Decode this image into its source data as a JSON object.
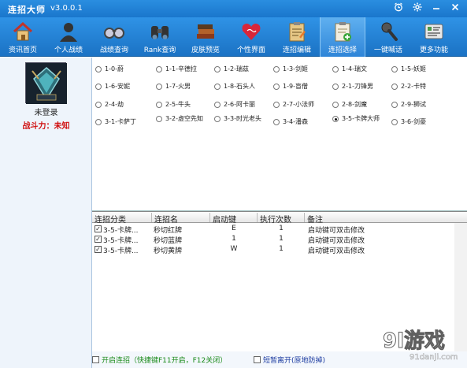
{
  "window": {
    "title": "连招大师",
    "version": "v3.0.0.1",
    "buttons": [
      "alarm-clock-icon",
      "gear-icon",
      "minimize-icon",
      "close-icon"
    ]
  },
  "toolbar": {
    "items": [
      {
        "label": "资讯首页",
        "icon": "house-icon"
      },
      {
        "label": "个人战绩",
        "icon": "user-silhouette-icon"
      },
      {
        "label": "战绩查询",
        "icon": "glasses-icon"
      },
      {
        "label": "Rank查询",
        "icon": "binoculars-icon"
      },
      {
        "label": "皮肤预览",
        "icon": "books-icon"
      },
      {
        "label": "个性界面",
        "icon": "heart-icon"
      },
      {
        "label": "连招编辑",
        "icon": "clipboard-edit-icon"
      },
      {
        "label": "连招选择",
        "icon": "clipboard-add-icon"
      },
      {
        "label": "一键喊话",
        "icon": "microphone-icon"
      },
      {
        "label": "更多功能",
        "icon": "more-apps-icon"
      }
    ],
    "active_index": 7
  },
  "sidebar": {
    "login_status": "未登录",
    "power_label": "战斗力：未知"
  },
  "combos": [
    [
      "1-0-蔚",
      "1-1-辛德拉",
      "1-2-瑞兹",
      "1-3-剑姬",
      "1-4-瑞文",
      "1-5-妖姬"
    ],
    [
      "1-6-安妮",
      "1-7-火男",
      "1-8-石头人",
      "1-9-盲僧",
      "2-1-刀锋男",
      "2-2-卡特"
    ],
    [
      "2-4-劫",
      "2-5-牛头",
      "2-6-阿卡丽",
      "2-7-小法师",
      "2-8-剑魔",
      "2-9-狮试"
    ],
    [
      "3-1-卡萨丁",
      "3-2-虚空先知",
      "3-3-时光老头",
      "3-4-潘森",
      "3-5-卡牌大师",
      "3-6-剑豪"
    ]
  ],
  "selected_combo": "3-5-卡牌大师",
  "table": {
    "headers": [
      "连招分类",
      "连招名",
      "启动键",
      "执行次数",
      "备注"
    ],
    "rows": [
      {
        "category": "3-5-卡牌...",
        "name": "秒切红牌",
        "key": "E",
        "count": "1",
        "note": "启动键可双击修改",
        "checked": true
      },
      {
        "category": "3-5-卡牌...",
        "name": "秒切蓝牌",
        "key": "1",
        "count": "1",
        "note": "启动键可双击修改",
        "checked": true
      },
      {
        "category": "3-5-卡牌...",
        "name": "秒切黄牌",
        "key": "W",
        "count": "1",
        "note": "启动键可双击修改",
        "checked": true
      }
    ]
  },
  "footer": {
    "enable_label": "开启连招（快捷键F11开启，F12关闭）",
    "away_label": "短暂离开(原地防掉)"
  },
  "watermark": {
    "logo": "9l游戏",
    "url": "91danji.com"
  }
}
